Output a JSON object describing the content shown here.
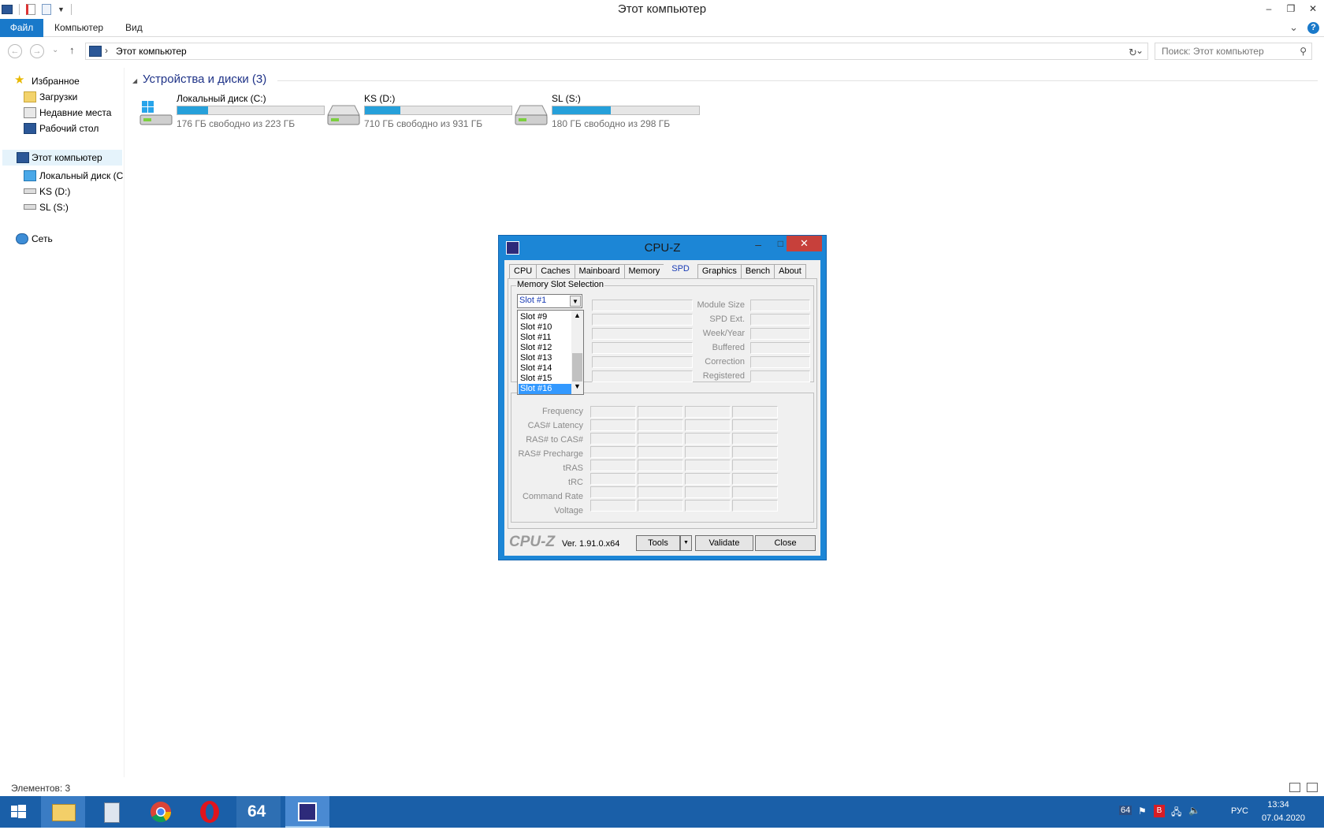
{
  "window": {
    "title": "Этот компьютер",
    "controls": {
      "minimize": "–",
      "restore": "❐",
      "close": "✕"
    }
  },
  "ribbon": {
    "tabs": [
      "Файл",
      "Компьютер",
      "Вид"
    ],
    "expand": "⌄",
    "help": "?"
  },
  "nav": {
    "back": "←",
    "forward": "→",
    "recent": "⌄",
    "up": "↑",
    "breadcrumb": "Этот компьютер",
    "chevron": "›",
    "dropdown": "⌄",
    "refresh": "↻",
    "search_placeholder": "Поиск: Этот компьютер"
  },
  "sidebar": {
    "favorites": "Избранное",
    "downloads": "Загрузки",
    "recent_places": "Недавние места",
    "desktop": "Рабочий стол",
    "this_pc": "Этот компьютер",
    "local_c": "Локальный диск (C",
    "ks_d": "KS (D:)",
    "sl_s": "SL (S:)",
    "network": "Сеть"
  },
  "content": {
    "group_title": "Устройства и диски (3)",
    "drives": [
      {
        "name": "Локальный диск (C:)",
        "free": "176 ГБ свободно из 223 ГБ",
        "used_fraction": 0.21
      },
      {
        "name": "KS (D:)",
        "free": "710 ГБ свободно из 931 ГБ",
        "used_fraction": 0.24
      },
      {
        "name": "SL (S:)",
        "free": "180 ГБ свободно из 298 ГБ",
        "used_fraction": 0.4
      }
    ]
  },
  "statusbar": {
    "items": "Элементов: 3"
  },
  "cpuz": {
    "title": "CPU-Z",
    "tabs": [
      "CPU",
      "Caches",
      "Mainboard",
      "Memory",
      "SPD",
      "Graphics",
      "Bench",
      "About"
    ],
    "active_tab": "SPD",
    "slot_group": "Memory Slot Selection",
    "slot_selected": "Slot #1",
    "slot_options": [
      "Slot #9",
      "Slot #10",
      "Slot #11",
      "Slot #12",
      "Slot #13",
      "Slot #14",
      "Slot #15",
      "Slot #16"
    ],
    "slot_highlighted": "Slot #16",
    "right_labels": [
      "Module Size",
      "SPD Ext.",
      "Week/Year",
      "Buffered",
      "Correction",
      "Registered"
    ],
    "timing_labels": [
      "Frequency",
      "CAS# Latency",
      "RAS# to CAS#",
      "RAS# Precharge",
      "tRAS",
      "tRC",
      "Command Rate",
      "Voltage"
    ],
    "logo": "CPU-Z",
    "version": "Ver. 1.91.0.x64",
    "tools_btn": "Tools",
    "tools_arrow": "▼",
    "validate_btn": "Validate",
    "close_btn": "Close",
    "controls": {
      "minimize": "–",
      "maximize": "□",
      "close": "✕"
    }
  },
  "taskbar": {
    "aida_label": "64",
    "tray_badge": "64",
    "language": "РУС",
    "time": "13:34",
    "date": "07.04.2020"
  },
  "colors": {
    "accent": "#1979ca",
    "taskbar": "#1a5fa8",
    "drive_bar": "#26a0da",
    "cpuz_frame": "#1c86d6"
  }
}
